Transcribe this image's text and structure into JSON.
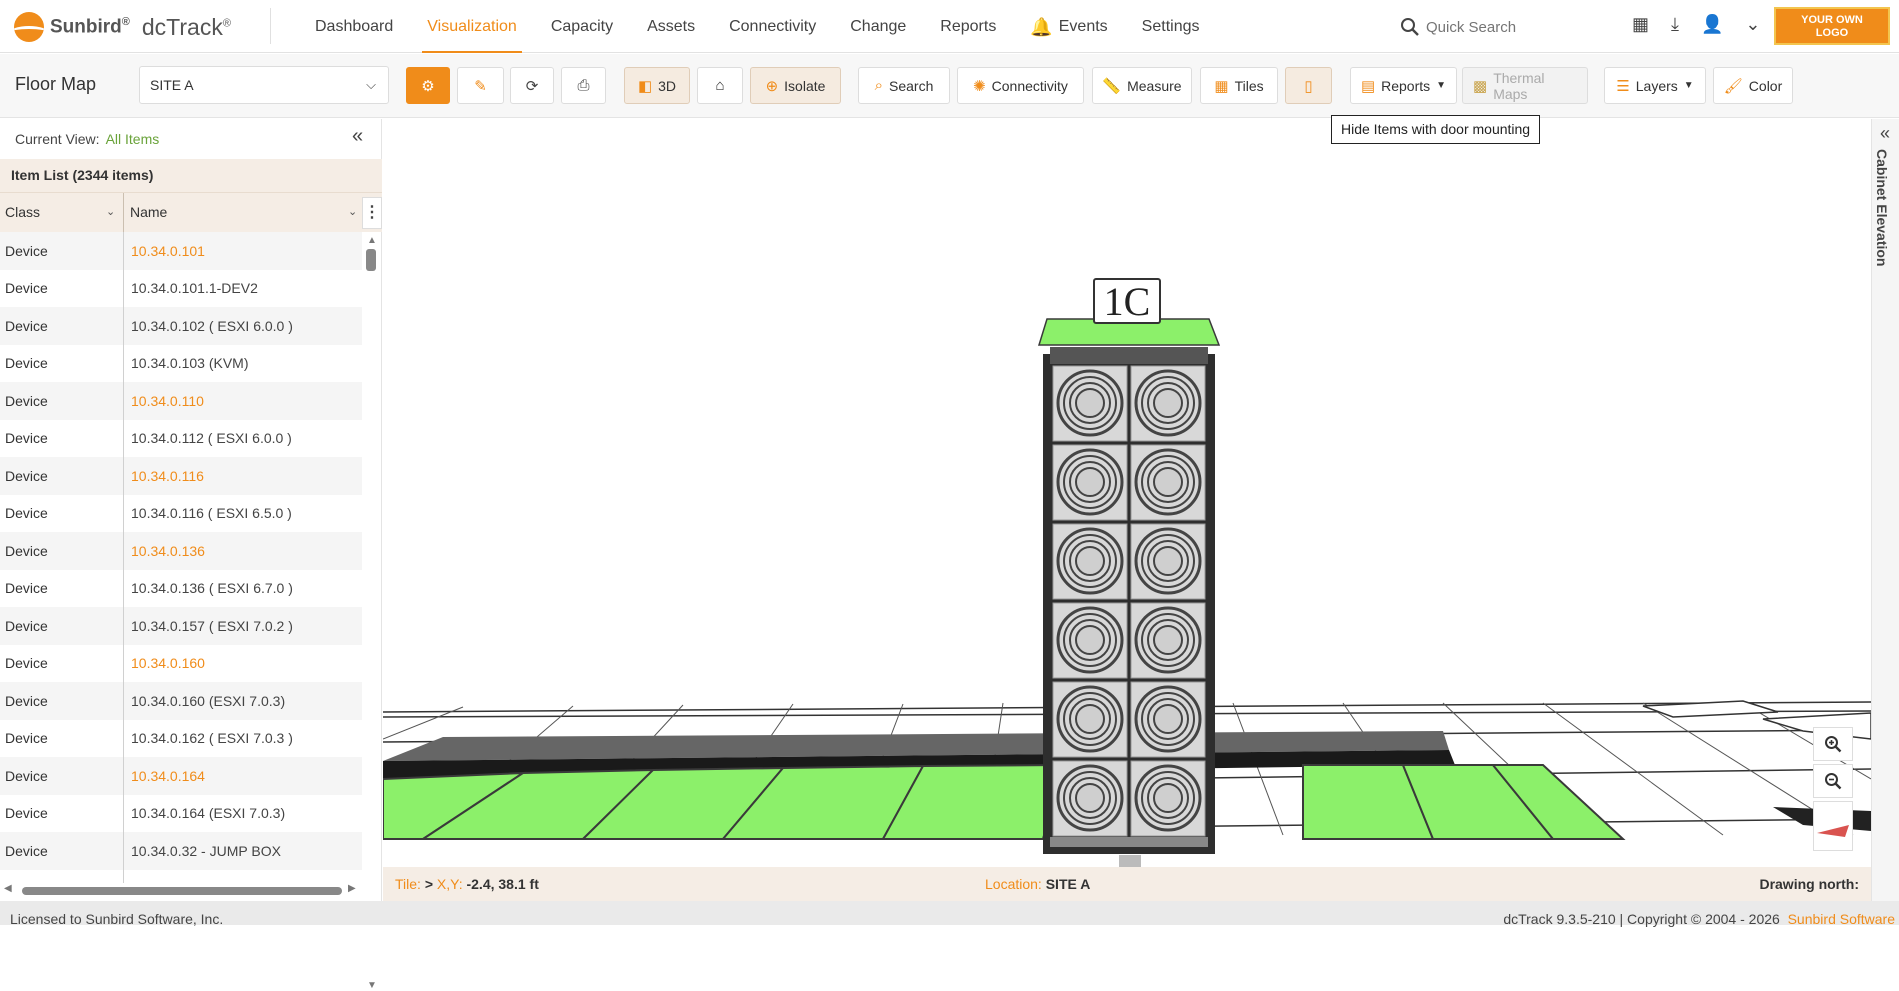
{
  "header": {
    "brand": "Sunbird",
    "product": "dcTrack",
    "nav": [
      "Dashboard",
      "Visualization",
      "Capacity",
      "Assets",
      "Connectivity",
      "Change",
      "Reports",
      "Events",
      "Settings"
    ],
    "active_nav": "Visualization",
    "search_placeholder": "Quick Search",
    "logo_text_1": "YOUR OWN",
    "logo_text_2": "LOGO",
    "icons": [
      "calendar-icon",
      "download-icon",
      "user-icon",
      "chevron-down-icon"
    ]
  },
  "toolbar": {
    "title": "Floor Map",
    "site": "SITE A",
    "btn_3d": "3D",
    "btn_isolate": "Isolate",
    "btn_search": "Search",
    "btn_connectivity": "Connectivity",
    "btn_measure": "Measure",
    "btn_tiles": "Tiles",
    "btn_reports": "Reports",
    "btn_thermal": "Thermal Maps",
    "btn_layers": "Layers",
    "btn_color": "Color",
    "tooltip": "Hide Items with door mounting"
  },
  "left_panel": {
    "current_view_label": "Current View:",
    "current_view_value": "All Items",
    "item_list_title": "Item List (2344 items)",
    "col_class": "Class",
    "col_name": "Name",
    "rows": [
      {
        "cls": "Device",
        "name": "10.34.0.101",
        "link": true
      },
      {
        "cls": "Device",
        "name": "10.34.0.101.1-DEV2",
        "link": false
      },
      {
        "cls": "Device",
        "name": "10.34.0.102 ( ESXI 6.0.0 )",
        "link": false
      },
      {
        "cls": "Device",
        "name": "10.34.0.103 (KVM)",
        "link": false
      },
      {
        "cls": "Device",
        "name": "10.34.0.110",
        "link": true
      },
      {
        "cls": "Device",
        "name": "10.34.0.112 ( ESXI 6.0.0 )",
        "link": false
      },
      {
        "cls": "Device",
        "name": "10.34.0.116",
        "link": true
      },
      {
        "cls": "Device",
        "name": "10.34.0.116 ( ESXI 6.5.0 )",
        "link": false
      },
      {
        "cls": "Device",
        "name": "10.34.0.136",
        "link": true
      },
      {
        "cls": "Device",
        "name": "10.34.0.136 ( ESXI 6.7.0 )",
        "link": false
      },
      {
        "cls": "Device",
        "name": "10.34.0.157 ( ESXI 7.0.2 )",
        "link": false
      },
      {
        "cls": "Device",
        "name": "10.34.0.160",
        "link": true
      },
      {
        "cls": "Device",
        "name": "10.34.0.160 (ESXI 7.0.3)",
        "link": false
      },
      {
        "cls": "Device",
        "name": "10.34.0.162 ( ESXI 7.0.3 )",
        "link": false
      },
      {
        "cls": "Device",
        "name": "10.34.0.164",
        "link": true
      },
      {
        "cls": "Device",
        "name": "10.34.0.164 (ESXI 7.0.3)",
        "link": false
      },
      {
        "cls": "Device",
        "name": "10.34.0.32 - JUMP BOX",
        "link": false
      }
    ]
  },
  "viewport": {
    "cabinet_label": "1C",
    "right_panel_label": "Cabinet Elevation",
    "colors": {
      "tile_green": "#8cf06a",
      "accent": "#f08c1a"
    }
  },
  "status": {
    "tile_label": "Tile:",
    "tile_value": ">",
    "xy_label": "X,Y:",
    "xy_value": "-2.4, 38.1 ft",
    "location_label": "Location:",
    "location_value": "SITE A",
    "north_label": "Drawing north:"
  },
  "footer": {
    "license": "Licensed to Sunbird Software, Inc.",
    "copyright": "dcTrack 9.3.5-210 | Copyright © 2004 - 2026",
    "brand": "Sunbird Software"
  }
}
